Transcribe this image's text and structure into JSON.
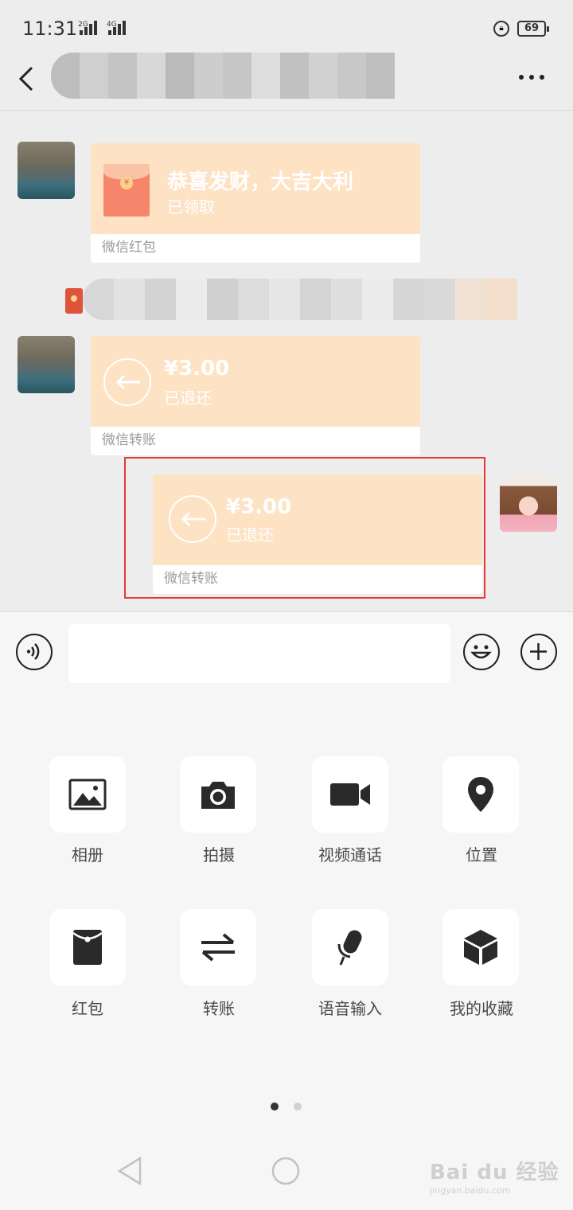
{
  "status_bar": {
    "time": "11:31",
    "network_1": "2G",
    "network_2": "4G",
    "battery": "69"
  },
  "header": {
    "back_icon": "chevron-left-icon",
    "more_icon": "more-horizontal-icon"
  },
  "messages": [
    {
      "type": "red_packet",
      "side": "left",
      "title": "恭喜发财，大吉大利",
      "status": "已领取",
      "footer": "微信红包"
    },
    {
      "type": "transfer",
      "side": "left",
      "amount": "¥3.00",
      "status": "已退还",
      "footer": "微信转账"
    },
    {
      "type": "transfer",
      "side": "right",
      "amount": "¥3.00",
      "status": "已退还",
      "footer": "微信转账"
    }
  ],
  "input_bar": {
    "voice_icon": "voice-icon",
    "emoji_icon": "emoji-icon",
    "add_icon": "plus-circle-icon",
    "value": ""
  },
  "panel": {
    "items": [
      {
        "label": "相册",
        "icon": "album-icon"
      },
      {
        "label": "拍摄",
        "icon": "camera-icon"
      },
      {
        "label": "视频通话",
        "icon": "video-call-icon"
      },
      {
        "label": "位置",
        "icon": "location-icon"
      },
      {
        "label": "红包",
        "icon": "red-packet-icon"
      },
      {
        "label": "转账",
        "icon": "transfer-icon"
      },
      {
        "label": "语音输入",
        "icon": "microphone-icon"
      },
      {
        "label": "我的收藏",
        "icon": "favorites-icon"
      }
    ],
    "page_indicator": {
      "current": 1,
      "total": 2
    }
  },
  "watermark": {
    "text": "Bai du 经验",
    "url": "jingyan.baidu.com"
  }
}
